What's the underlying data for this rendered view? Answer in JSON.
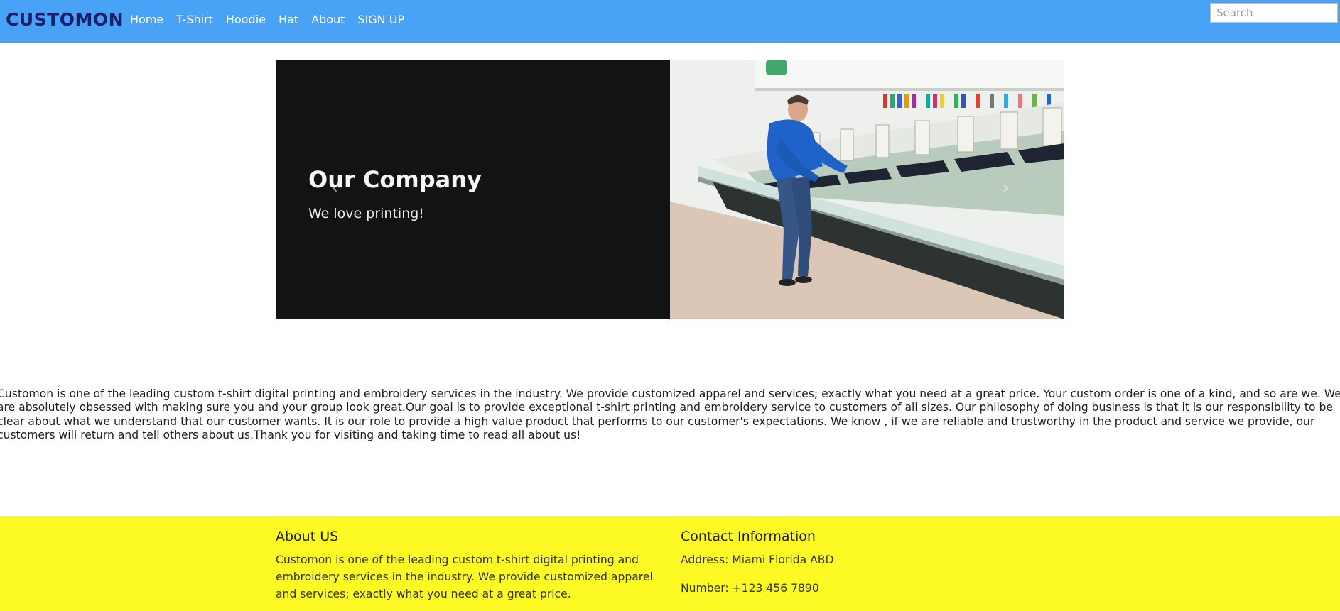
{
  "brand": {
    "logo_text": "CUSTOMON",
    "logo_color": "#1b1f6b"
  },
  "colors": {
    "navbar": "#48a2f5",
    "footer": "#fdf925",
    "slide_dark": "#131313"
  },
  "nav": {
    "links": [
      "Home",
      "T-Shirt",
      "Hoodie",
      "Hat",
      "About",
      "SIGN UP"
    ]
  },
  "search": {
    "placeholder": "Search",
    "value": ""
  },
  "carousel": {
    "title": "Our Company",
    "subtitle": "We love printing!",
    "prev_icon": "chevron-left-icon",
    "next_icon": "chevron-right-icon"
  },
  "about_paragraph": "Customon is one of the leading custom t-shirt digital printing and embroidery services in the industry. We provide customized apparel and services; exactly what you need at a great price. Your custom order is one of a kind, and so are we. We are absolutely obsessed with making sure you and your group look great.Our goal is to provide exceptional t-shirt printing and embroidery service to customers of all sizes. Our philosophy of doing business is that it is our responsibility to be clear about what we understand that our customer wants. It is our role to provide a high value product that performs to our customer's expectations. We know , if we are reliable and trustworthy in the product and service we provide, our customers will return and tell others about us.Thank you for visiting and taking time to read all about us!",
  "footer": {
    "about": {
      "heading": "About US",
      "text": "Customon is one of the leading custom t-shirt digital printing and embroidery services in the industry. We provide customized apparel and services; exactly what you need at a great price."
    },
    "contact": {
      "heading": "Contact Information",
      "address": "Address: Miami Florida ABD",
      "number": "Number: +123 456 7890"
    }
  }
}
